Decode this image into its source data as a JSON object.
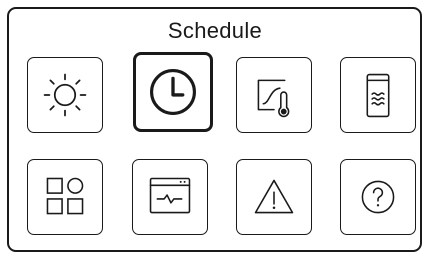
{
  "screen": {
    "title": "Schedule"
  },
  "menu": {
    "items": [
      {
        "id": "mode",
        "icon": "sun-icon",
        "selected": false
      },
      {
        "id": "schedule",
        "icon": "clock-icon",
        "selected": true
      },
      {
        "id": "heating-curve",
        "icon": "curve-thermometer-icon",
        "selected": false
      },
      {
        "id": "hot-water",
        "icon": "water-tank-icon",
        "selected": false
      },
      {
        "id": "apps",
        "icon": "grid-icon",
        "selected": false
      },
      {
        "id": "monitor",
        "icon": "monitor-icon",
        "selected": false
      },
      {
        "id": "alarms",
        "icon": "warning-icon",
        "selected": false
      },
      {
        "id": "help",
        "icon": "help-icon",
        "selected": false
      }
    ]
  }
}
